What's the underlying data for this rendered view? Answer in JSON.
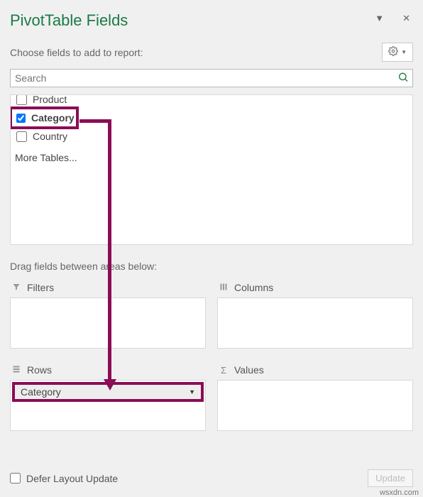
{
  "title": "PivotTable Fields",
  "subtitle": "Choose fields to add to report:",
  "search": {
    "placeholder": "Search"
  },
  "fields": [
    {
      "label": "Product",
      "checked": false
    },
    {
      "label": "Category",
      "checked": true
    },
    {
      "label": "Country",
      "checked": false
    }
  ],
  "more_tables": "More Tables...",
  "drag_text": "Drag fields between areas below:",
  "areas": {
    "filters": {
      "label": "Filters"
    },
    "columns": {
      "label": "Columns"
    },
    "rows": {
      "label": "Rows",
      "items": [
        "Category"
      ]
    },
    "values": {
      "label": "Values"
    }
  },
  "defer_label": "Defer Layout Update",
  "update_label": "Update",
  "watermark": "wsxdn.com"
}
